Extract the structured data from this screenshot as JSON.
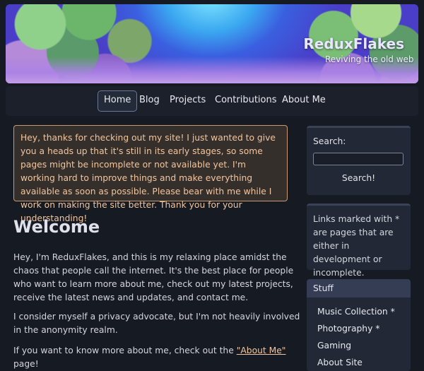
{
  "header": {
    "title": "ReduxFlakes",
    "subtitle": "Reviving the old web"
  },
  "nav": {
    "items": [
      "Home",
      "Blog",
      "Projects",
      "Contributions",
      "About Me"
    ],
    "active": "Home"
  },
  "notice": {
    "text": "Hey, thanks for checking out my site! I just wanted to give you a heads up that it's still in its early stages, so some pages might be incomplete or not available yet. I'm working hard to improve things and make everything available as soon as possible. Please bear with me while I work on making the site better. Thank you for your understanding!"
  },
  "main": {
    "heading": "Welcome",
    "p1": "Hey, I'm ReduxFlakes, and this is my relaxing place amidst the chaos that people call the internet. It's the best place for people who want to learn more about me, check out my latest projects, receive the latest news and updates, and contact me.",
    "p2": "I consider myself a privacy advocate, but I'm not heavily involved in the anonymity realm.",
    "p3_before": "If you want to know more about me, check out the ",
    "p3_link": "\"About Me\"",
    "p3_after": " page!"
  },
  "sidebar": {
    "search_label": "Search:",
    "search_value": "",
    "search_button": "Search!",
    "info_text": "Links marked with * are pages that are either in development or incomplete.",
    "stuff_title": "Stuff",
    "stuff_items": [
      "Music Collection *",
      "Photography *",
      "Gaming",
      "About Site"
    ]
  },
  "colors": {
    "background": "#161a23",
    "notice_text": "#f2c59d",
    "notice_border": "#c79a72"
  }
}
